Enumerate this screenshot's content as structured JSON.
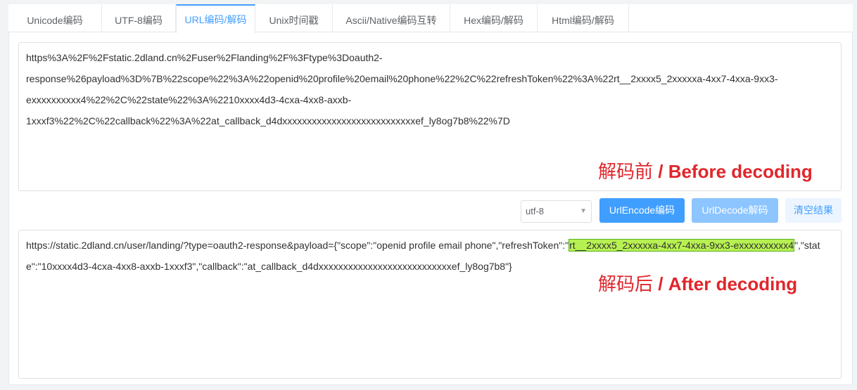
{
  "tabs": [
    {
      "label": "Unicode编码"
    },
    {
      "label": "UTF-8编码"
    },
    {
      "label": "URL编码/解码"
    },
    {
      "label": "Unix时间戳"
    },
    {
      "label": "Ascii/Native编码互转"
    },
    {
      "label": "Hex编码/解码"
    },
    {
      "label": "Html编码/解码"
    }
  ],
  "active_tab": "URL编码/解码",
  "input": {
    "lines": [
      "https%3A%2F%2Fstatic.2dland.cn%2Fuser%2Flanding%2F%3Ftype%3Doauth2-",
      "response%26payload%3D%7B%22scope%22%3A%22openid%20profile%20email%20phone%22%2C%22refreshToken%22%3A%22rt__2xxxx5_2xxxxxa-4xx7-4xxa-9xx3-",
      "exxxxxxxxxx4%22%2C%22state%22%3A%2210xxxx4d3-4cxa-4xx8-axxb-",
      "1xxxf3%22%2C%22callback%22%3A%22at_callback_d4dxxxxxxxxxxxxxxxxxxxxxxxxxxxef_ly8og7b8%22%7D"
    ]
  },
  "annotation_before": {
    "cn": "解码前",
    "sep": " / ",
    "en": "Before decoding"
  },
  "controls": {
    "charset": "utf-8",
    "encode_label": "UrlEncode编码",
    "decode_label": "UrlDecode解码",
    "clear_label": "清空结果"
  },
  "output": {
    "prefix": "https://static.2dland.cn/user/landing/?type=oauth2-response&payload={\"scope\":\"openid profile email phone\",\"refreshToken\":\"",
    "highlight": "rt__2xxxx5_2xxxxxa-4xx7-4xxa-9xx3-exxxxxxxxxx4",
    "suffix": "\",\"state\":\"10xxxx4d3-4cxa-4xx8-axxb-1xxxf3\",\"callback\":\"at_callback_d4dxxxxxxxxxxxxxxxxxxxxxxxxxxxef_ly8og7b8\"}"
  },
  "annotation_after": {
    "cn": "解码后",
    "sep": " / ",
    "en": "After decoding"
  },
  "colors": {
    "accent": "#409eff",
    "annotation": "#e0262b",
    "highlight": "#b7f051"
  }
}
